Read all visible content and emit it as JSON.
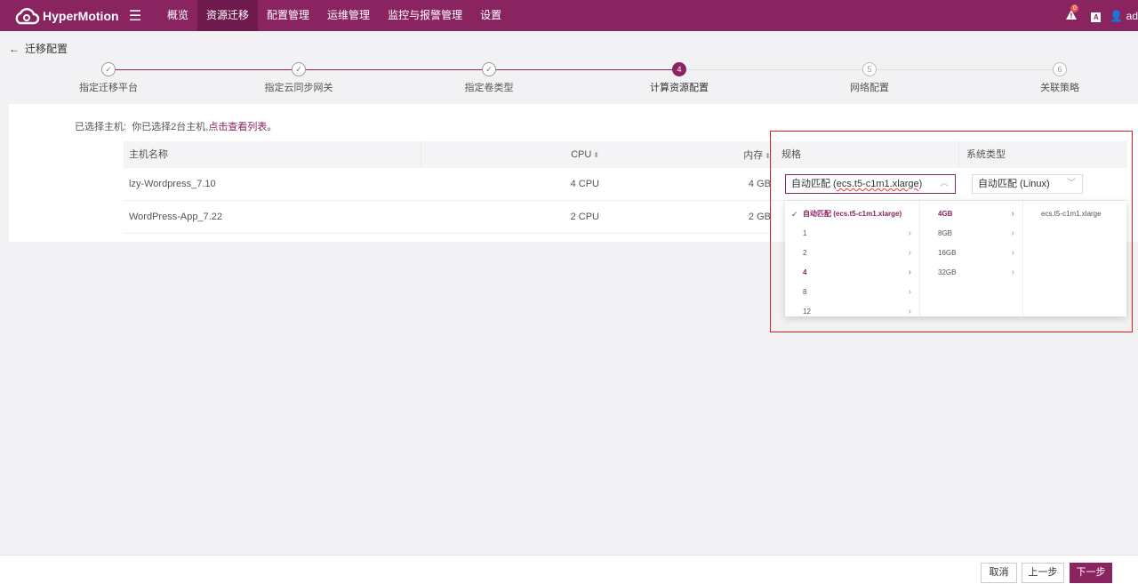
{
  "app": {
    "name": "HyperMotion"
  },
  "nav": {
    "items": [
      "概览",
      "资源迁移",
      "配置管理",
      "运维管理",
      "监控与报警管理",
      "设置"
    ],
    "active_index": 1
  },
  "header_right": {
    "notification_count": "0",
    "lang_label": "A",
    "user_label": "ad"
  },
  "page": {
    "title": "迁移配置"
  },
  "steps": [
    {
      "label": "指定迁移平台",
      "state": "done",
      "marker": "✓"
    },
    {
      "label": "指定云同步网关",
      "state": "done",
      "marker": "✓"
    },
    {
      "label": "指定卷类型",
      "state": "done",
      "marker": "✓"
    },
    {
      "label": "计算资源配置",
      "state": "active",
      "marker": "4"
    },
    {
      "label": "网络配置",
      "state": "todo",
      "marker": "5"
    },
    {
      "label": "关联策略",
      "state": "todo",
      "marker": "6"
    }
  ],
  "selection": {
    "label": "已选择主机:",
    "text": "你已选择2台主机,",
    "link": "点击查看列表",
    "suffix": "。"
  },
  "table": {
    "headers": {
      "name": "主机名称",
      "cpu": "CPU",
      "mem": "内存",
      "spec": "规格",
      "os": "系统类型"
    },
    "rows": [
      {
        "name": "lzy-Wordpress_7.10",
        "cpu": "4 CPU",
        "mem": "4 GB"
      },
      {
        "name": "WordPress-App_7.22",
        "cpu": "2 CPU",
        "mem": "2 GB"
      }
    ]
  },
  "spec_select": {
    "prefix": "自动匹配 (",
    "value": "ecs.t5-c1m1.xlarge",
    "suffix": ")"
  },
  "os_select": {
    "value": "自动匹配 (Linux)"
  },
  "cascade": {
    "col1": [
      {
        "label": "自动匹配 (ecs.t5-c1m1.xlarge)",
        "selected": true
      },
      {
        "label": "1"
      },
      {
        "label": "2"
      },
      {
        "label": "4",
        "selected": true
      },
      {
        "label": "8"
      },
      {
        "label": "12"
      }
    ],
    "col2": [
      {
        "label": "4GB",
        "selected": true
      },
      {
        "label": "8GB"
      },
      {
        "label": "16GB"
      },
      {
        "label": "32GB"
      }
    ],
    "col3": [
      {
        "label": "ecs.t5-c1m1.xlarge"
      }
    ]
  },
  "footer": {
    "cancel": "取消",
    "prev": "上一步",
    "next": "下一步"
  },
  "colors": {
    "brand": "#8a2461",
    "highlight": "#e31b1b"
  },
  "icons": {
    "logo": "cloud-logo-icon",
    "menu": "hamburger-icon",
    "alert": "alert-icon",
    "user": "user-icon",
    "back": "back-arrow-icon",
    "check": "check-icon",
    "chevron": "chevron-right-icon"
  }
}
